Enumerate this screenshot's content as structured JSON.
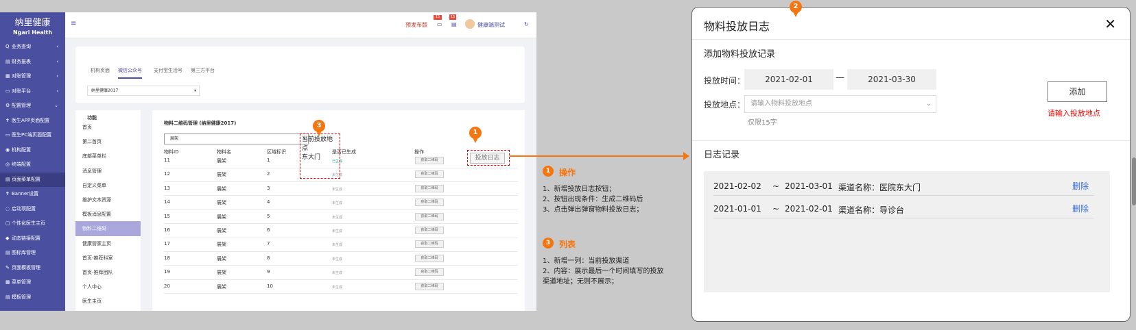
{
  "app": {
    "logo_cn": "纳里健康",
    "logo_en": "Ngari Health"
  },
  "sidebar": {
    "items": [
      {
        "icon": "Q",
        "label": "业务查询",
        "arrow": "‹"
      },
      {
        "icon": "▤",
        "label": "财务报表",
        "arrow": "‹"
      },
      {
        "icon": "▦",
        "label": "对账管理",
        "arrow": "‹"
      },
      {
        "icon": "▭",
        "label": "对账平台",
        "arrow": "‹"
      },
      {
        "icon": "⚙",
        "label": "配置管理",
        "arrow": "⌄"
      },
      {
        "icon": "✝",
        "label": "医生APP页面配置",
        "arrow": ""
      },
      {
        "icon": "▭",
        "label": "医生PC端页面配置",
        "arrow": ""
      },
      {
        "icon": "◉",
        "label": "机构配置",
        "arrow": ""
      },
      {
        "icon": "◎",
        "label": "终端配置",
        "arrow": ""
      },
      {
        "icon": "▤",
        "label": "页面菜单配置",
        "arrow": ""
      },
      {
        "icon": "✝",
        "label": "Banner设置",
        "arrow": ""
      },
      {
        "icon": "◌",
        "label": "启动项配置",
        "arrow": ""
      },
      {
        "icon": "▢",
        "label": "个性化医生主页",
        "arrow": ""
      },
      {
        "icon": "◆",
        "label": "动态链接配置",
        "arrow": ""
      },
      {
        "icon": "▤",
        "label": "图标库管理",
        "arrow": ""
      },
      {
        "icon": "✎",
        "label": "页面模板管理",
        "arrow": ""
      },
      {
        "icon": "▦",
        "label": "菜单管理",
        "arrow": ""
      },
      {
        "icon": "▤",
        "label": "模板管理",
        "arrow": ""
      }
    ]
  },
  "topbar": {
    "menu_icon": "≡",
    "publish": "预发布版",
    "badge_count": "15",
    "user": "健康端测试",
    "refresh": "↻"
  },
  "tabs": [
    {
      "label": "机构页面"
    },
    {
      "label": "微信公众号"
    },
    {
      "label": "支付宝生活号"
    },
    {
      "label": "第三方平台"
    }
  ],
  "org_select": {
    "value": "纳里健康2017",
    "arrow": "▾"
  },
  "fn_panel": {
    "header": "功能",
    "items": [
      "首页",
      "第二首页",
      "底部菜单栏",
      "消息管理",
      "自定义菜单",
      "维护文本资源",
      "模板消息配置",
      "物料二维码",
      "健康管家主页",
      "首页-推荐科室",
      "首页-推荐团队",
      "个人中心",
      "医生主页"
    ]
  },
  "main_panel": {
    "title": "物料二维码管理 (纳里健康2017)",
    "filter": {
      "value": "展架",
      "arrow": "▾"
    },
    "columns": [
      "物料ID",
      "物料名",
      "区域标识",
      "当前投放地点",
      "是否已生成",
      "操作"
    ],
    "rows": [
      {
        "id": "11",
        "name": "展架",
        "area": "1",
        "status": "已生成",
        "action": "获取二维码"
      },
      {
        "id": "12",
        "name": "展架",
        "area": "2",
        "status": "未生成",
        "action": "获取二维码"
      },
      {
        "id": "13",
        "name": "展架",
        "area": "3",
        "status": "未生成",
        "action": "获取二维码"
      },
      {
        "id": "14",
        "name": "展架",
        "area": "4",
        "status": "未生成",
        "action": "获取二维码"
      },
      {
        "id": "15",
        "name": "展架",
        "area": "5",
        "status": "未生成",
        "action": "获取二维码"
      },
      {
        "id": "16",
        "name": "展架",
        "area": "6",
        "status": "未生成",
        "action": "获取二维码"
      },
      {
        "id": "17",
        "name": "展架",
        "area": "7",
        "status": "未生成",
        "action": "获取二维码"
      },
      {
        "id": "18",
        "name": "展架",
        "area": "8",
        "status": "未生成",
        "action": "获取二维码"
      },
      {
        "id": "19",
        "name": "展架",
        "area": "9",
        "status": "未生成",
        "action": "获取二维码"
      },
      {
        "id": "20",
        "name": "展架",
        "area": "10",
        "status": "未生成",
        "action": "获取二维码"
      }
    ],
    "location_cell": "东大门",
    "log_button": "投放日志"
  },
  "annotations": {
    "badge1": "1",
    "badge2": "2",
    "badge3": "3",
    "note1_title": "操作",
    "note1_lines": [
      "1、新增投放日志按钮；",
      "2、按钮出现条件：生成二维码后",
      "3、点击弹出弹窗物料投放日志；"
    ],
    "note3_title": "列表",
    "note3_lines": [
      "1、新增一列：当前投放渠道",
      "2、内容：展示最后一个时间填写的投放",
      "渠道地址；无则不展示；"
    ]
  },
  "modal": {
    "title": "物料投放日志",
    "close": "✕",
    "add_section": "添加物料投放记录",
    "time_label": "投放时间：",
    "start_date": "2021-02-01",
    "dash": "—",
    "end_date": "2021-03-30",
    "loc_label": "投放地点：",
    "loc_placeholder": "请输入物料投放地点",
    "loc_arrow": "⌄",
    "hint": "仅限15字",
    "add_button": "添加",
    "error": "请输入投放地点",
    "log_section": "日志记录",
    "logs": [
      {
        "start": "2021-02-02",
        "sep": "~",
        "end": "2021-03-01",
        "channel": "渠道名称：医院东大门",
        "delete": "删除"
      },
      {
        "start": "2021-01-01",
        "sep": "~",
        "end": "2021-02-01",
        "channel": "渠道名称：导诊台",
        "delete": "删除"
      }
    ]
  },
  "colors": {
    "accent": "#4b4fa0",
    "annotation": "#f5750e",
    "error": "#ee0000",
    "link": "#3c6fd8"
  }
}
